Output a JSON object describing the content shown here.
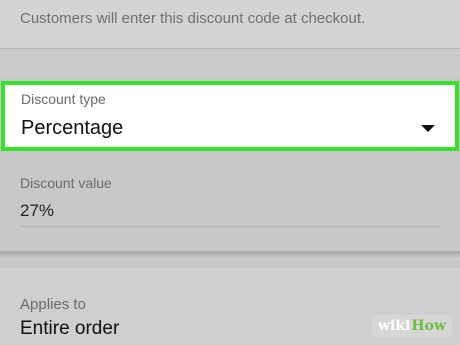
{
  "helper": {
    "text": "Customers will enter this discount code at checkout."
  },
  "discount_type": {
    "label": "Discount type",
    "value": "Percentage"
  },
  "discount_value": {
    "label": "Discount value",
    "value": "27%"
  },
  "applies_to": {
    "label": "Applies to",
    "value": "Entire order"
  },
  "watermark": {
    "part1": "wiki",
    "part2": "How"
  },
  "colors": {
    "highlight": "#36e02c",
    "background": "#c8c8c8"
  },
  "icons": {
    "dropdown": "dropdown-arrow-icon"
  }
}
